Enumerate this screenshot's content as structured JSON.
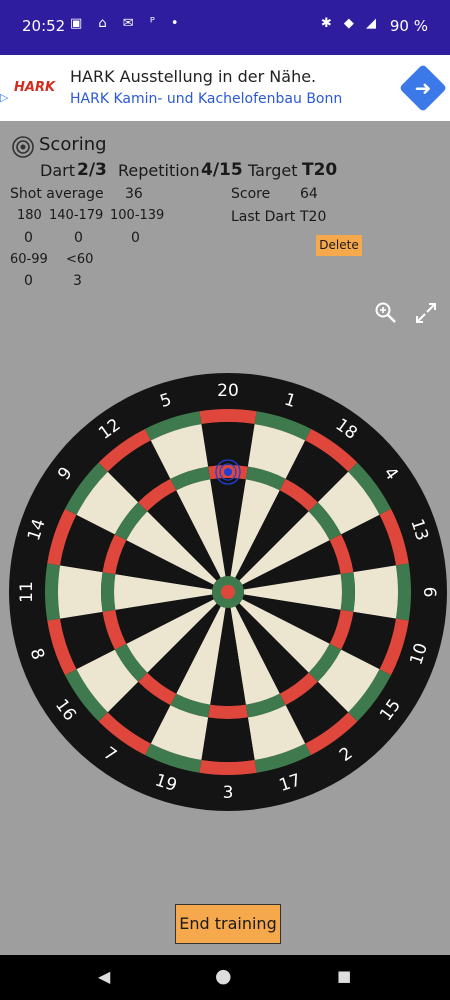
{
  "status": {
    "time": "20:52",
    "battery": "90 %",
    "left_icons": "▣ ⌂ ✉ ᴾ •",
    "right_icons": "✱ ◆ ◢"
  },
  "ad": {
    "logo": "HARK",
    "title": "HARK Ausstellung in der Nähe.",
    "subtitle": "HARK Kamin- und Kachelofenbau Bonn",
    "adchoice": "▷",
    "go_icon": "directions-icon",
    "go_glyph": "➜"
  },
  "header": {
    "title": "Scoring",
    "icon": "target-icon"
  },
  "info": {
    "dart_label": "Dart",
    "dart_value": "2/3",
    "repetition_label": "Repetition",
    "repetition_value": "4/15",
    "target_label": "Target",
    "target_value": "T20"
  },
  "stats": {
    "shot_average_label": "Shot average",
    "shot_average_value": "36",
    "score_label": "Score",
    "score_value": "64",
    "last_dart_label": "Last Dart",
    "last_dart_value": "T20",
    "ranges": [
      {
        "label": "180",
        "value": "0"
      },
      {
        "label": "140-179",
        "value": "0"
      },
      {
        "label": "100-139",
        "value": "0"
      },
      {
        "label": "60-99",
        "value": "0"
      },
      {
        "label": "<60",
        "value": "3"
      }
    ]
  },
  "buttons": {
    "delete": "Delete",
    "end_training": "End training"
  },
  "toolbar": {
    "zoom_icon": "zoom-in-icon",
    "expand_icon": "fullscreen-icon"
  },
  "dartboard": {
    "numbers": [
      "20",
      "1",
      "18",
      "4",
      "13",
      "6",
      "10",
      "15",
      "2",
      "17",
      "3",
      "19",
      "7",
      "16",
      "8",
      "11",
      "14",
      "9",
      "12",
      "5"
    ],
    "colors": {
      "black": "#141414",
      "cream": "#ece6d0",
      "red": "#e0473c",
      "green": "#3e7a4d",
      "marker": "#1f3fd6"
    }
  },
  "nav": {
    "back": "◀",
    "home": "●",
    "recents": "■"
  }
}
